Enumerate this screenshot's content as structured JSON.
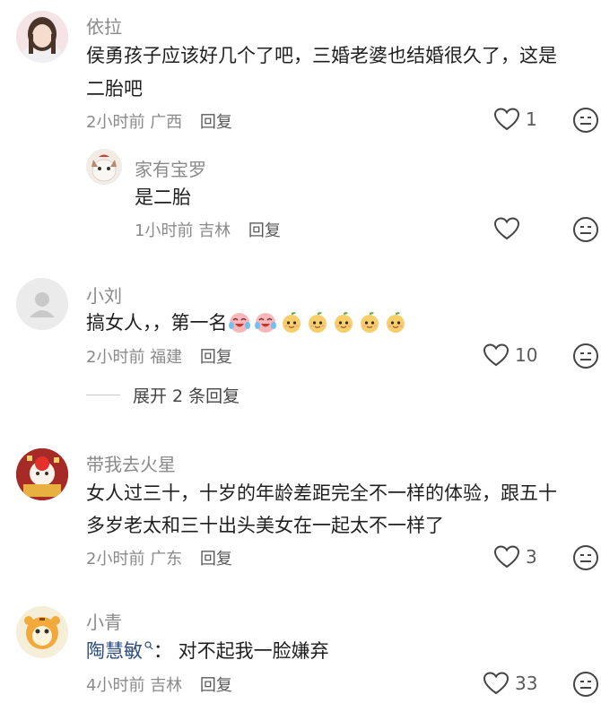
{
  "comments": [
    {
      "username": "依拉",
      "text_line1": "侯勇孩子应该好几个了吧，三婚老婆也结婚很久了，这是",
      "text_line2": "二胎吧",
      "time": "2小时前",
      "location": "广西",
      "reply_label": "回复",
      "likes": "1",
      "replies": [
        {
          "username": "家有宝罗",
          "text": "是二胎",
          "time": "1小时前",
          "location": "吉林",
          "reply_label": "回复",
          "likes": ""
        }
      ]
    },
    {
      "username": "小刘",
      "text": "搞女人，，第一名",
      "emoji_icons": [
        "crying-laughing-icon",
        "crying-laughing-icon",
        "peach-face-icon",
        "peach-face-icon",
        "peach-face-icon",
        "peach-face-icon",
        "peach-face-icon"
      ],
      "time": "2小时前",
      "location": "福建",
      "reply_label": "回复",
      "likes": "10",
      "expand_label": "展开 2 条回复"
    },
    {
      "username": "带我去火星",
      "text_line1": "女人过三十，十岁的年龄差距完全不一样的体验，跟五十",
      "text_line2": "多岁老太和三十出头美女在一起太不一样了",
      "time": "2小时前",
      "location": "广东",
      "reply_label": "回复",
      "likes": "3"
    },
    {
      "username": "小青",
      "mention": "陶慧敏",
      "text": "：  对不起我一脸嫌弃",
      "time": "4小时前",
      "location": "吉林",
      "reply_label": "回复",
      "likes": "33"
    }
  ],
  "colors": {
    "secondary_text": "#8a8a8a",
    "primary_text": "#1f1f1f",
    "mention": "#2d4d7c"
  }
}
